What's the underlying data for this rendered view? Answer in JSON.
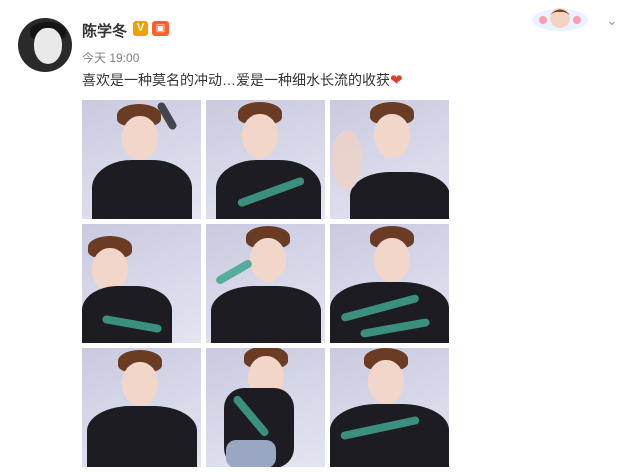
{
  "post": {
    "username": "陈学冬",
    "badge_v": "V",
    "time": "今天 19:00",
    "text": "喜欢是一种莫名的冲动…爱是一种细水长流的收获",
    "emoji": "❤"
  },
  "header": {
    "more_icon": "chevron-down-icon",
    "sticker_icon": "avatar-sticker-icon"
  },
  "colors": {
    "username": "#333333",
    "time": "#808080",
    "heart": "#e33b2f",
    "verified": "#f0a000"
  },
  "photos": [
    {
      "name": "photo-1"
    },
    {
      "name": "photo-2"
    },
    {
      "name": "photo-3"
    },
    {
      "name": "photo-4"
    },
    {
      "name": "photo-5"
    },
    {
      "name": "photo-6"
    },
    {
      "name": "photo-7"
    },
    {
      "name": "photo-8"
    },
    {
      "name": "photo-9"
    }
  ]
}
